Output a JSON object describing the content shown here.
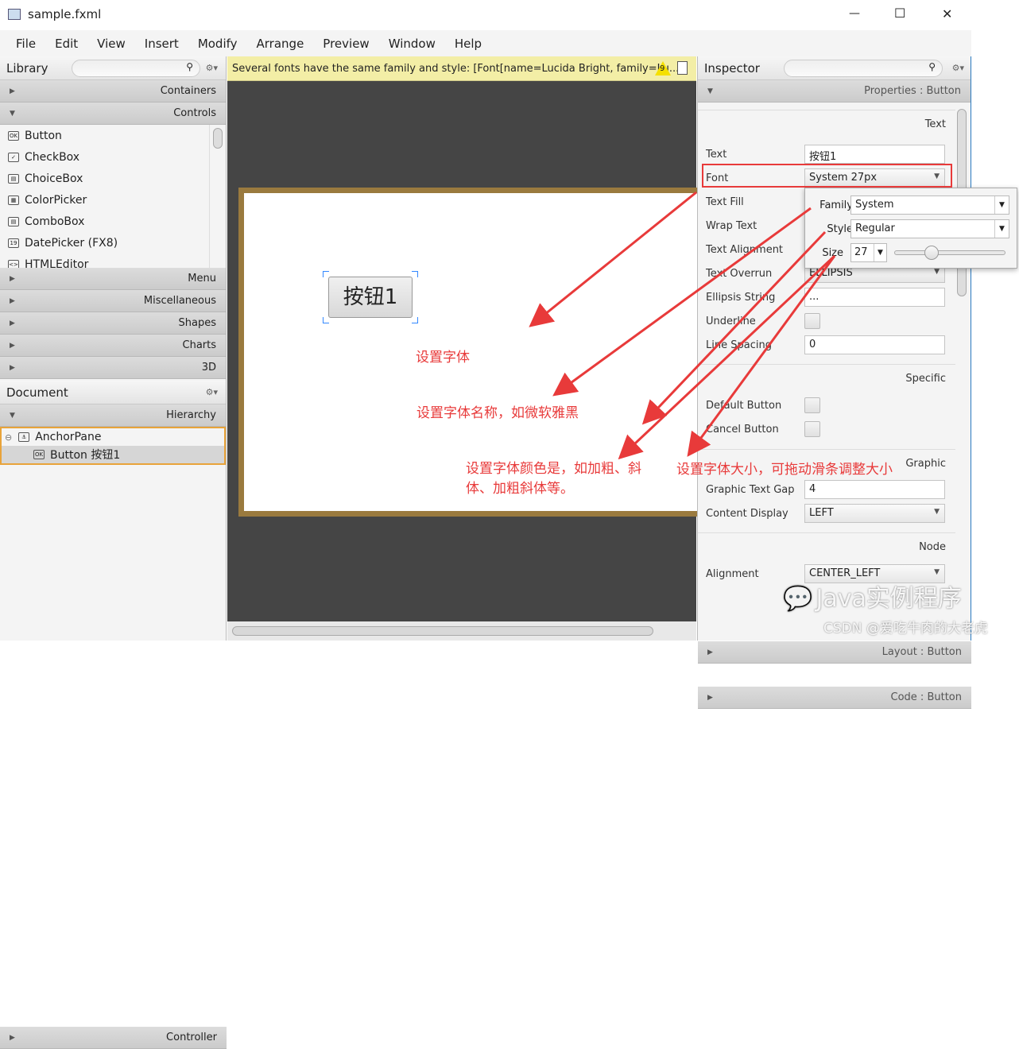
{
  "window": {
    "title": "sample.fxml",
    "minimize": "—",
    "maximize": "☐",
    "close": "✕"
  },
  "menu": [
    "File",
    "Edit",
    "View",
    "Insert",
    "Modify",
    "Arrange",
    "Preview",
    "Window",
    "Help"
  ],
  "library": {
    "title": "Library",
    "sections_top": [
      "Containers",
      "Controls"
    ],
    "items": [
      {
        "icon": "OK",
        "label": "Button"
      },
      {
        "icon": "✓",
        "label": "CheckBox"
      },
      {
        "icon": "▤",
        "label": "ChoiceBox"
      },
      {
        "icon": "▦",
        "label": "ColorPicker"
      },
      {
        "icon": "▤",
        "label": "ComboBox"
      },
      {
        "icon": "19",
        "label": "DatePicker  (FX8)"
      },
      {
        "icon": "<>",
        "label": "HTMLEditor"
      }
    ],
    "sections_bottom": [
      "Menu",
      "Miscellaneous",
      "Shapes",
      "Charts",
      "3D"
    ]
  },
  "document": {
    "title": "Document",
    "section": "Hierarchy",
    "tree": [
      {
        "label": "AnchorPane"
      },
      {
        "label": "Button  按钮1"
      }
    ],
    "controller": "Controller"
  },
  "warning": {
    "text": "Several fonts have the same family and style: [Font[name=Lucida Bright, family=Lu...",
    "count": "9"
  },
  "canvas": {
    "button_text": "按钮1"
  },
  "inspector": {
    "title": "Inspector",
    "properties_label": "Properties : Button",
    "groups": {
      "text": "Text",
      "specific": "Specific",
      "graphic": "Graphic",
      "node": "Node"
    },
    "text_props": [
      {
        "label": "Text",
        "value": "按钮1"
      },
      {
        "label": "Font",
        "value": "System 27px"
      },
      {
        "label": "Text Fill"
      },
      {
        "label": "Wrap Text"
      },
      {
        "label": "Text Alignment"
      },
      {
        "label": "Text Overrun",
        "value": "ELLIPSIS"
      },
      {
        "label": "Ellipsis String",
        "value": "..."
      },
      {
        "label": "Underline"
      },
      {
        "label": "Line Spacing",
        "value": "0"
      }
    ],
    "specific_props": [
      {
        "label": "Default Button"
      },
      {
        "label": "Cancel Button"
      }
    ],
    "graphic_props": [
      {
        "label": "Graphic Text Gap",
        "value": "4"
      },
      {
        "label": "Content Display",
        "value": "LEFT"
      }
    ],
    "node_props": [
      {
        "label": "Alignment",
        "value": "CENTER_LEFT"
      }
    ],
    "layout_label": "Layout : Button",
    "code_label": "Code : Button"
  },
  "font_popup": {
    "family_label": "Family",
    "family": "System",
    "style_label": "Style",
    "style": "Regular",
    "size_label": "Size",
    "size": "27",
    "slider_fraction": 0.3
  },
  "annotations": [
    "设置字体",
    "设置字体名称，如微软雅黑",
    "设置字体颜色是，如加粗、斜体、加粗斜体等。",
    "设置字体大小，可拖动滑条调整大小"
  ],
  "watermark": {
    "brand": "Java实例程序",
    "credit": "CSDN @爱吃牛肉的大老虎"
  },
  "colors": {
    "annotation": "#e83a3a",
    "warning_bg": "#f3eea6",
    "canvas_border": "#9a7a3e",
    "selection": "#e8a33a"
  }
}
